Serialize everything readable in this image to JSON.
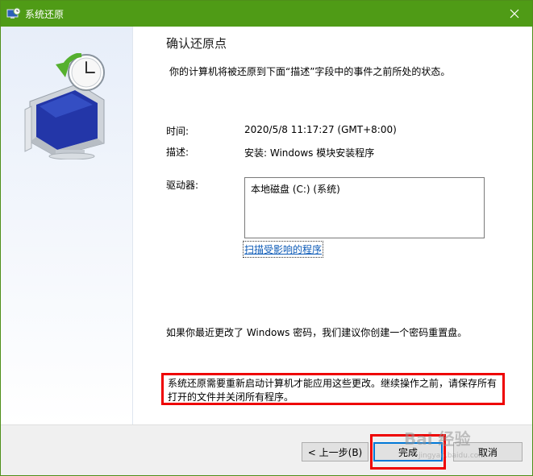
{
  "window": {
    "title": "系统还原"
  },
  "page": {
    "heading": "确认还原点",
    "subtitle": "你的计算机将被还原到下面“描述”字段中的事件之前所处的状态。"
  },
  "details": {
    "time_label": "时间:",
    "time_value": "2020/5/8 11:17:27 (GMT+8:00)",
    "desc_label": "描述:",
    "desc_value": "安装: Windows 模块安装程序",
    "drives_label": "驱动器:",
    "drives": [
      "本地磁盘 (C:) (系统)"
    ]
  },
  "links": {
    "scan": "扫描受影响的程序"
  },
  "notes": {
    "password": "如果你最近更改了 Windows 密码，我们建议你创建一个密码重置盘。",
    "restart_line1": "系统还原需要重新启动计算机才能应用这些更改。继续操作之前，请保存所有",
    "restart_line2": "打开的文件并关闭所有程序。"
  },
  "buttons": {
    "back": "< 上一步(B)",
    "finish": "完成",
    "cancel": "取消"
  },
  "watermark": {
    "brand": "Bai 经验",
    "sub": "jingyan.baidu.com"
  },
  "colors": {
    "titlebar": "#4f9b16",
    "link": "#0b59b6",
    "highlight": "#ee0000"
  }
}
